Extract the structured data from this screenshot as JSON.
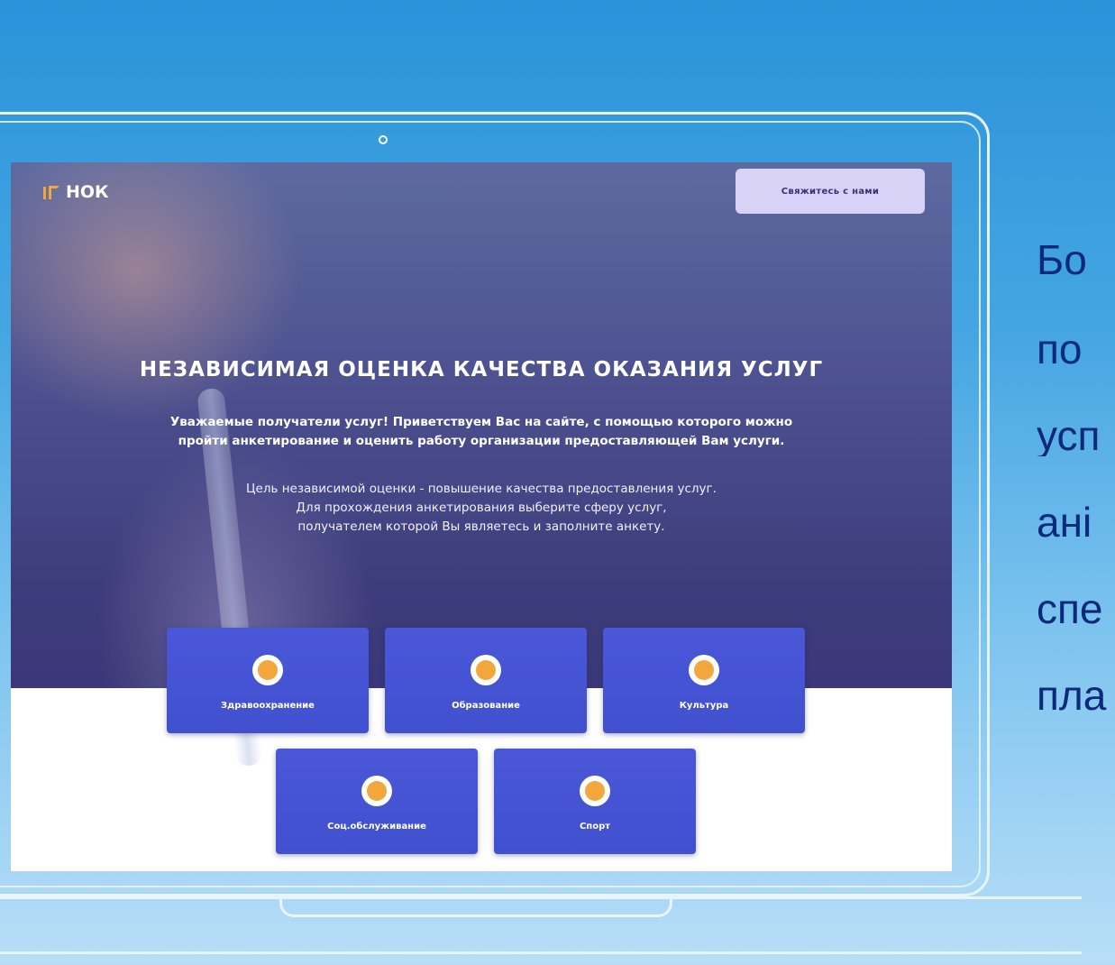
{
  "site": {
    "logo_text": "НОК",
    "contact_button": "Свяжитесь с нами",
    "title": "НЕЗАВИСИМАЯ ОЦЕНКА КАЧЕСТВА ОКАЗАНИЯ УСЛУГ",
    "lead_line1": "Уважаемые получатели услуг! Приветствуем Вас на сайте, с помощью которого можно",
    "lead_line2": "пройти анкетирование и оценить работу организации предоставляющей Вам услуги.",
    "sub_line1": "Цель независимой оценки - повышение качества предоставления услуг.",
    "sub_line2": "Для прохождения анкетирования выберите сферу услуг,",
    "sub_line3": "получателем которой Вы являетесь и заполните анкету.",
    "services": [
      {
        "label": "Здравоохранение",
        "icon": "medical-case-icon"
      },
      {
        "label": "Образование",
        "icon": "graduation-cap-icon"
      },
      {
        "label": "Культура",
        "icon": "column-icon"
      },
      {
        "label": "Соц.обслуживание",
        "icon": "flower-icon"
      },
      {
        "label": "Спорт",
        "icon": "ball-icon"
      }
    ]
  },
  "slide_text": [
    "Бо",
    "по",
    "усп",
    "ані",
    "спе",
    "пла"
  ],
  "colors": {
    "background": "#2a93d9",
    "card": "#4a58d8",
    "icon_accent": "#f3a63c",
    "slide_text": "#0b2a7a",
    "contact_button": "#d8d2f7"
  }
}
